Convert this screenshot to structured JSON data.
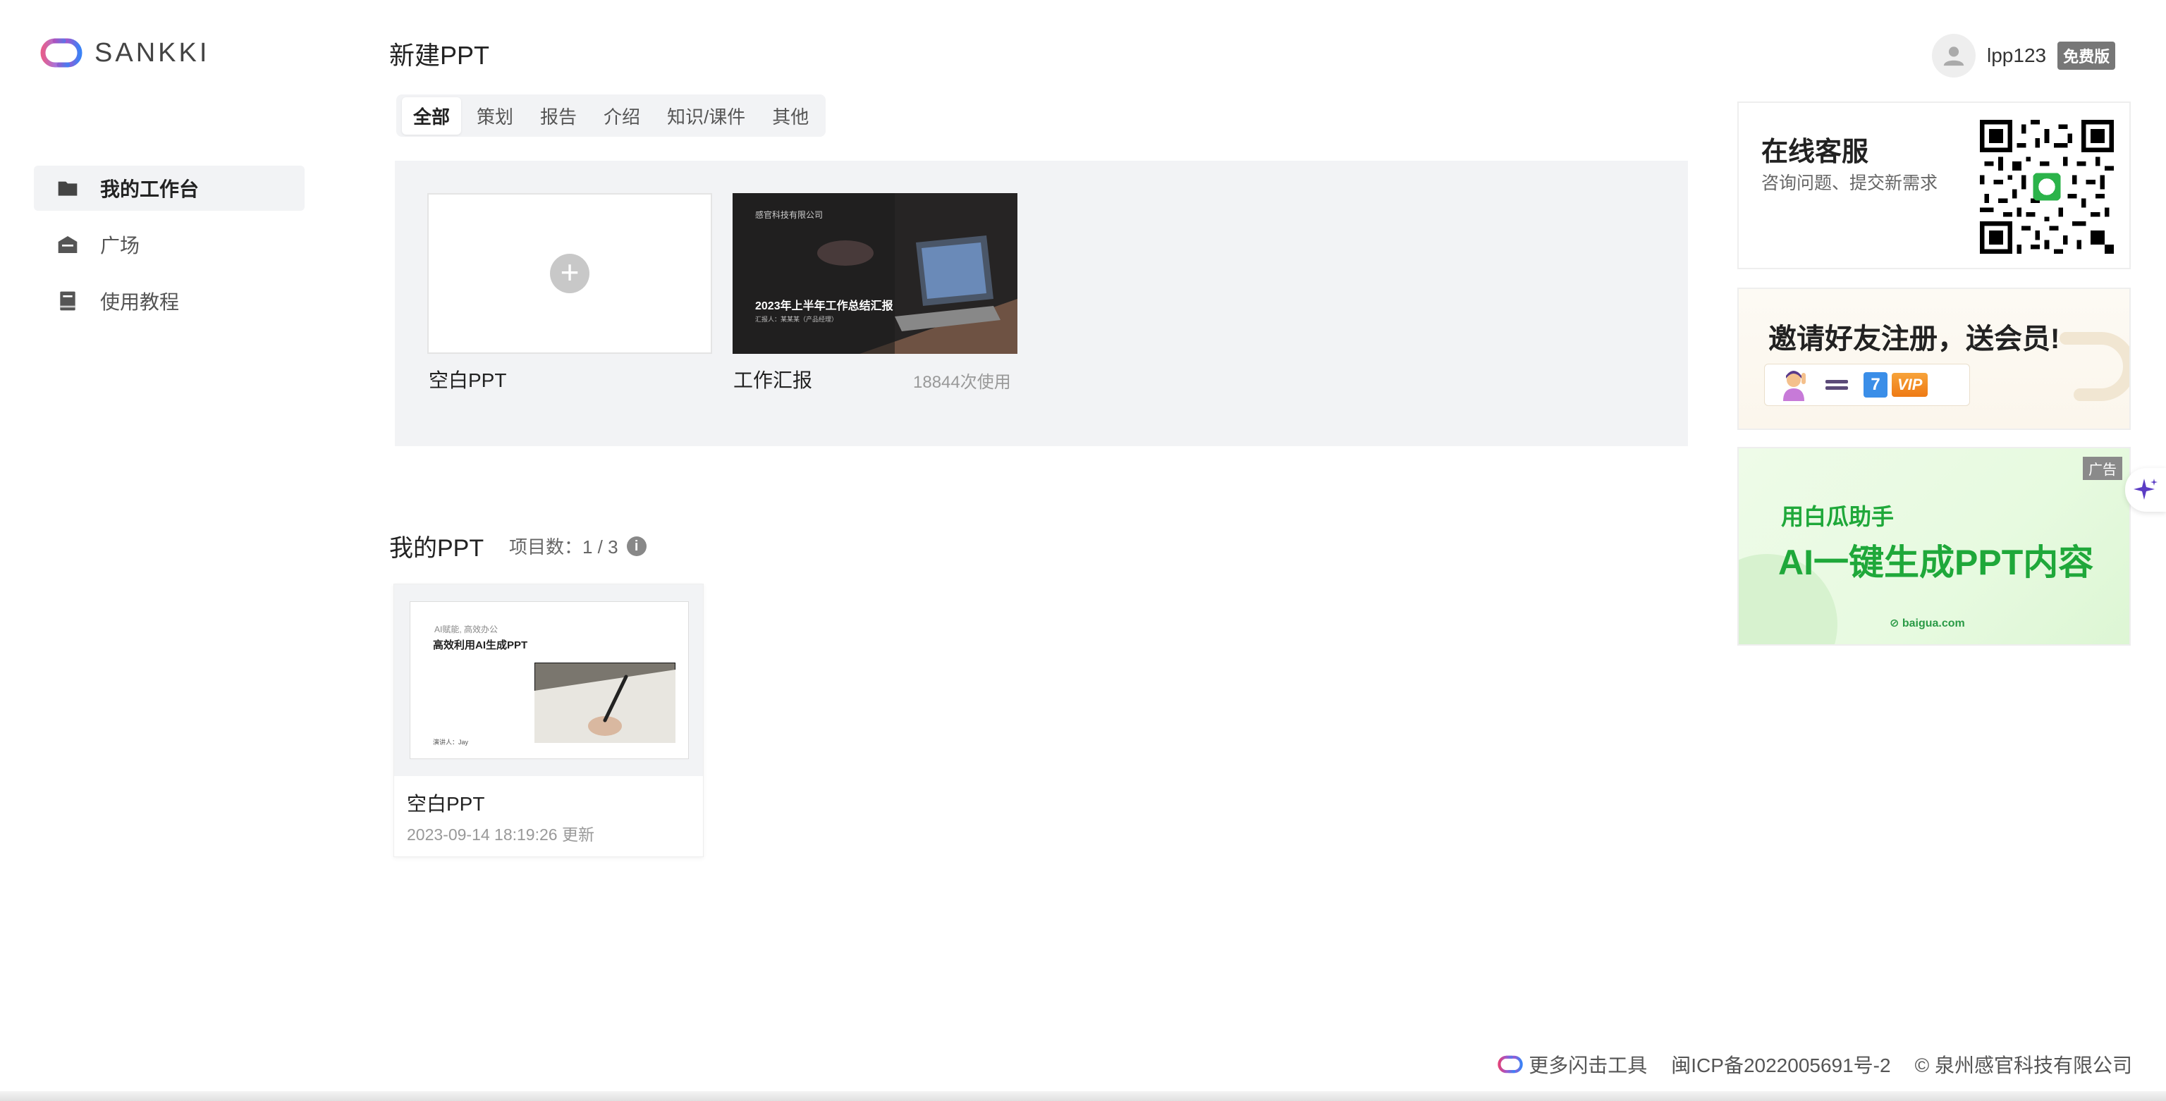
{
  "brand": {
    "name": "SANKKI"
  },
  "sidebar": {
    "items": [
      {
        "label": "我的工作台",
        "icon": "folder-icon"
      },
      {
        "label": "广场",
        "icon": "house-icon"
      },
      {
        "label": "使用教程",
        "icon": "book-icon"
      }
    ]
  },
  "new_ppt": {
    "title": "新建PPT",
    "tabs": [
      "全部",
      "策划",
      "报告",
      "介绍",
      "知识/课件",
      "其他"
    ],
    "templates": [
      {
        "label": "空白PPT"
      },
      {
        "label": "工作汇报",
        "uses": "18844次使用",
        "thumb_company": "感官科技有限公司",
        "thumb_title": "2023年上半年工作总结汇报",
        "thumb_sub": "汇报人：某某某（产品经理）"
      }
    ]
  },
  "my_ppt": {
    "title": "我的PPT",
    "count_label": "项目数：1 / 3",
    "projects": [
      {
        "name": "空白PPT",
        "updated": "2023-09-14 18:19:26 更新",
        "thumb_kicker": "AI赋能, 高效办公",
        "thumb_title": "高效利用AI生成PPT",
        "thumb_author": "演讲人：Jay"
      }
    ]
  },
  "user": {
    "name": "lpp123",
    "plan": "免费版"
  },
  "support": {
    "title": "在线客服",
    "subtitle": "咨询问题、提交新需求"
  },
  "invite": {
    "title": "邀请好友注册，送会员!",
    "days": "7",
    "vip": "VIP"
  },
  "ad": {
    "tag": "广告",
    "line1": "用白瓜助手",
    "line2": "AI一键生成PPT内容",
    "url": "baigua.com"
  },
  "footer": {
    "more_tools": "更多闪击工具",
    "icp": "闽ICP备2022005691号-2",
    "copyright": "© 泉州感官科技有限公司"
  },
  "colors": {
    "accent_green": "#1fa83a",
    "badge_gray": "#777777",
    "panel_gray": "#f2f3f5"
  }
}
